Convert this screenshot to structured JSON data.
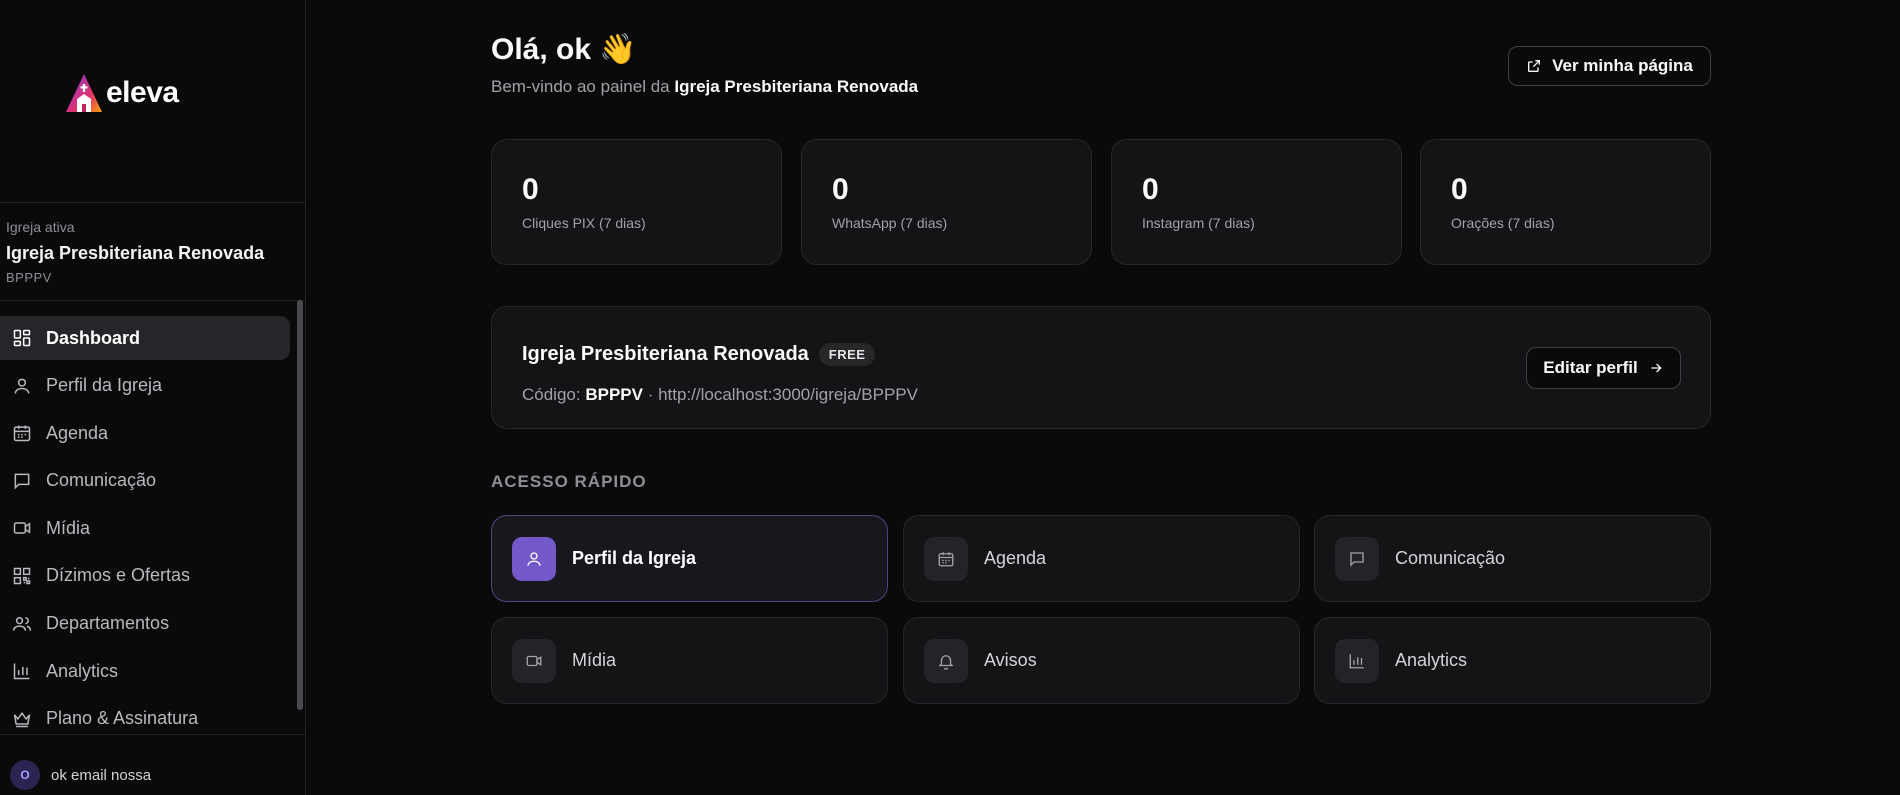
{
  "brand": {
    "name": "eleva"
  },
  "sidebar": {
    "church_label": "Igreja ativa",
    "church_name": "Igreja Presbiteriana Renovada",
    "church_code": "BPPPV",
    "items": [
      {
        "label": "Dashboard",
        "icon": "dashboard-icon",
        "active": true
      },
      {
        "label": "Perfil da Igreja",
        "icon": "user-icon"
      },
      {
        "label": "Agenda",
        "icon": "calendar-icon"
      },
      {
        "label": "Comunicação",
        "icon": "message-icon"
      },
      {
        "label": "Mídia",
        "icon": "video-icon"
      },
      {
        "label": "Dízimos e Ofertas",
        "icon": "qr-code-icon"
      },
      {
        "label": "Departamentos",
        "icon": "users-icon"
      },
      {
        "label": "Analytics",
        "icon": "bar-chart-icon"
      },
      {
        "label": "Plano & Assinatura",
        "icon": "crown-icon"
      }
    ],
    "user": {
      "initial": "O",
      "name": "ok email nossa"
    }
  },
  "header": {
    "greeting": "Olá, ok 👋",
    "welcome_prefix": "Bem-vindo ao painel da ",
    "welcome_church": "Igreja Presbiteriana Renovada",
    "view_page_label": "Ver minha página"
  },
  "stats": [
    {
      "value": "0",
      "label": "Cliques PIX (7 dias)"
    },
    {
      "value": "0",
      "label": "WhatsApp (7 dias)"
    },
    {
      "value": "0",
      "label": "Instagram (7 dias)"
    },
    {
      "value": "0",
      "label": "Orações (7 dias)"
    }
  ],
  "profile": {
    "name": "Igreja Presbiteriana Renovada",
    "plan_badge": "FREE",
    "code_label": "Código: ",
    "code": "BPPPV",
    "url_text": " · http://localhost:3000/igreja/BPPPV",
    "edit_label": "Editar perfil"
  },
  "quick_access": {
    "title": "ACESSO RÁPIDO",
    "items": [
      {
        "label": "Perfil da Igreja",
        "icon": "user-icon",
        "active": true
      },
      {
        "label": "Agenda",
        "icon": "calendar-icon"
      },
      {
        "label": "Comunicação",
        "icon": "message-icon"
      },
      {
        "label": "Mídia",
        "icon": "video-icon"
      },
      {
        "label": "Avisos",
        "icon": "bell-icon"
      },
      {
        "label": "Analytics",
        "icon": "bar-chart-icon"
      }
    ]
  },
  "colors": {
    "accent": "#7358c9",
    "background": "#0a0a0b",
    "card": "#141416"
  }
}
